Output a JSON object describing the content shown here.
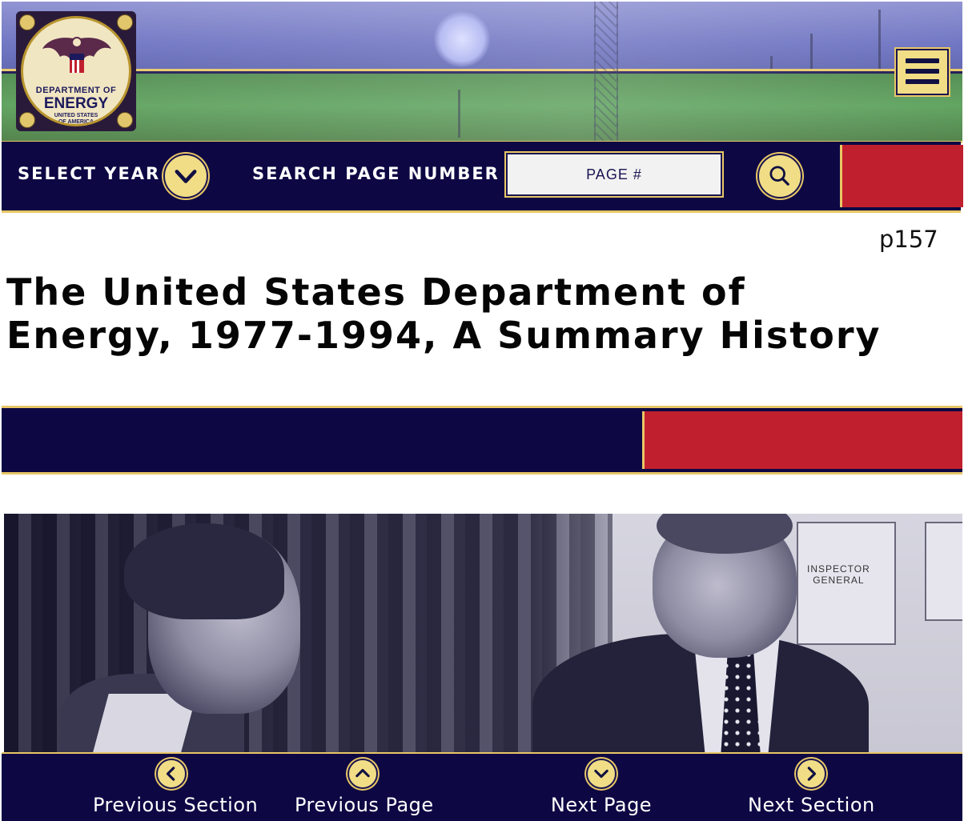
{
  "header": {
    "seal": {
      "line1": "DEPARTMENT OF",
      "line2": "ENERGY",
      "line3": "UNITED STATES",
      "line4": "OF AMERICA"
    },
    "menu_icon": "hamburger-menu-icon"
  },
  "toolbar": {
    "select_year_label": "SELECT YEAR",
    "search_page_label": "SEARCH PAGE NUMBER",
    "page_input_placeholder": "PAGE #",
    "page_input_value": ""
  },
  "page": {
    "page_number": "p157",
    "title": "The United States Department of Energy, 1977-1994, A Summary History"
  },
  "photo": {
    "sign_line1": "INSPECTOR",
    "sign_line2": "GENERAL"
  },
  "bottom_nav": {
    "previous_section": "Previous Section",
    "previous_page": "Previous Page",
    "next_page": "Next Page",
    "next_section": "Next Section"
  },
  "colors": {
    "navy": "#0d0844",
    "gold": "#e8c766",
    "button_fill": "#f1dd85",
    "red": "#c0202e"
  }
}
